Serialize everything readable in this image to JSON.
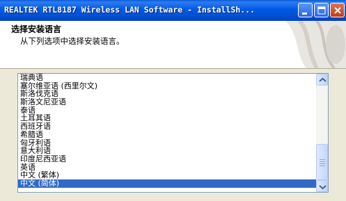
{
  "window": {
    "title": "REALTEK RTL8187 Wireless LAN Software - InstallSh...",
    "controls": [
      "minimize-icon",
      "maximize-icon",
      "close-icon"
    ]
  },
  "header": {
    "title": "选择安装语言",
    "subtitle": "从下列选项中选择安装语言。"
  },
  "language_list": {
    "items": [
      "瑞典语",
      "塞尔维亚语 (西里尔文)",
      "斯洛伐克语",
      "斯洛文尼亚语",
      "泰语",
      "土耳其语",
      "西班牙语",
      "希腊语",
      "匈牙利语",
      "意大利语",
      "印度尼西亚语",
      "英语",
      "中文 (繁体)",
      "中文 (简体)"
    ],
    "selected": "中文 (简体)"
  },
  "colors": {
    "title_bar": "#0058e6",
    "selection": "#316ac5",
    "dialog_face": "#ece9d8"
  }
}
